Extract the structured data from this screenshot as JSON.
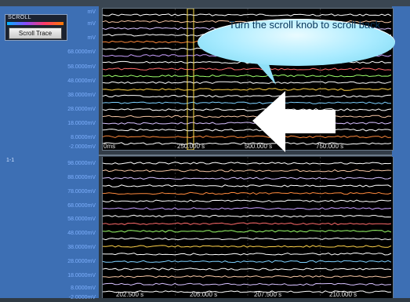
{
  "scroll_panel": {
    "title": "SCROLL",
    "button_label": "Scroll Trace"
  },
  "top_axis_labels": [
    "mV",
    "mV",
    "mV",
    "68.0000mV",
    "58.0000mV",
    "48.0000mV",
    "38.0000mV",
    "28.0000mV",
    "18.0000mV",
    "8.0000mV",
    "-2.0000mV"
  ],
  "top_time_labels": [
    "0ms",
    "250.000 s",
    "500.000 s",
    "750.000 s"
  ],
  "channel_label": "1-1",
  "bottom_axis_labels": [
    "98.0000mV",
    "88.0000mV",
    "78.0000mV",
    "68.0000mV",
    "58.0000mV",
    "48.0000mV",
    "38.0000mV",
    "28.0000mV",
    "18.0000mV",
    "8.0000mV",
    "-2.0000mV"
  ],
  "bottom_time_labels": [
    "202.500 s",
    "205.000 s",
    "207.500 s",
    "210.000 s"
  ],
  "callout": {
    "text": "Turn the scroll knob to scroll back"
  },
  "colors": {
    "panel": "#3d6fb4",
    "screen": "#000000",
    "callout": "#a9ebff",
    "arrow": "#ffffff"
  },
  "icons": {
    "arrow": "left-arrow-icon"
  }
}
